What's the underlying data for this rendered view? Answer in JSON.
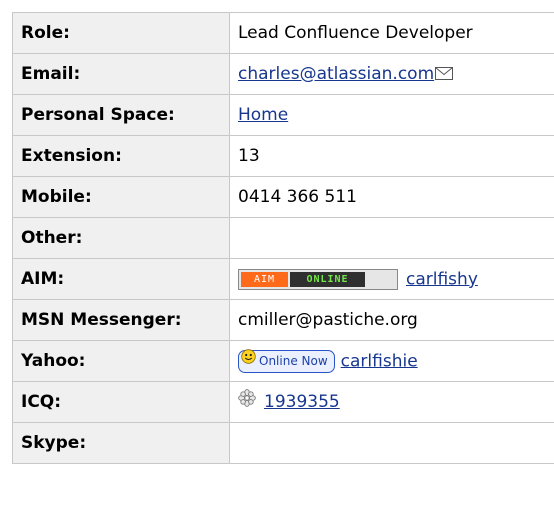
{
  "profile": {
    "role": {
      "label": "Role:",
      "value": "Lead Confluence Developer"
    },
    "email": {
      "label": "Email:",
      "value": "charles@atlassian.com",
      "icon": "mail-icon"
    },
    "personal_space": {
      "label": "Personal Space:",
      "value": "Home"
    },
    "extension": {
      "label": "Extension:",
      "value": "13"
    },
    "mobile": {
      "label": "Mobile:",
      "value": "0414 366 511"
    },
    "other": {
      "label": "Other:",
      "value": ""
    },
    "aim": {
      "label": "AIM:",
      "badge_left": "AIM",
      "badge_status": "ONLINE",
      "badge_colors": {
        "aim": "#ff6a1a",
        "status_bg": "#2f2f2f",
        "status_text": "#73e64a"
      },
      "value": "carlfishy"
    },
    "msn": {
      "label": "MSN Messenger:",
      "value": "cmiller@pastiche.org"
    },
    "yahoo": {
      "label": "Yahoo:",
      "badge_text": "Online Now",
      "icon": "smiley-icon",
      "value": "carlfishie"
    },
    "icq": {
      "label": "ICQ:",
      "icon": "icq-flower-icon",
      "value": "1939355"
    },
    "skype": {
      "label": "Skype:",
      "value": ""
    }
  },
  "colors": {
    "label_bg": "#f0f0f0",
    "border": "#c8c8c8",
    "link": "#17378f"
  }
}
